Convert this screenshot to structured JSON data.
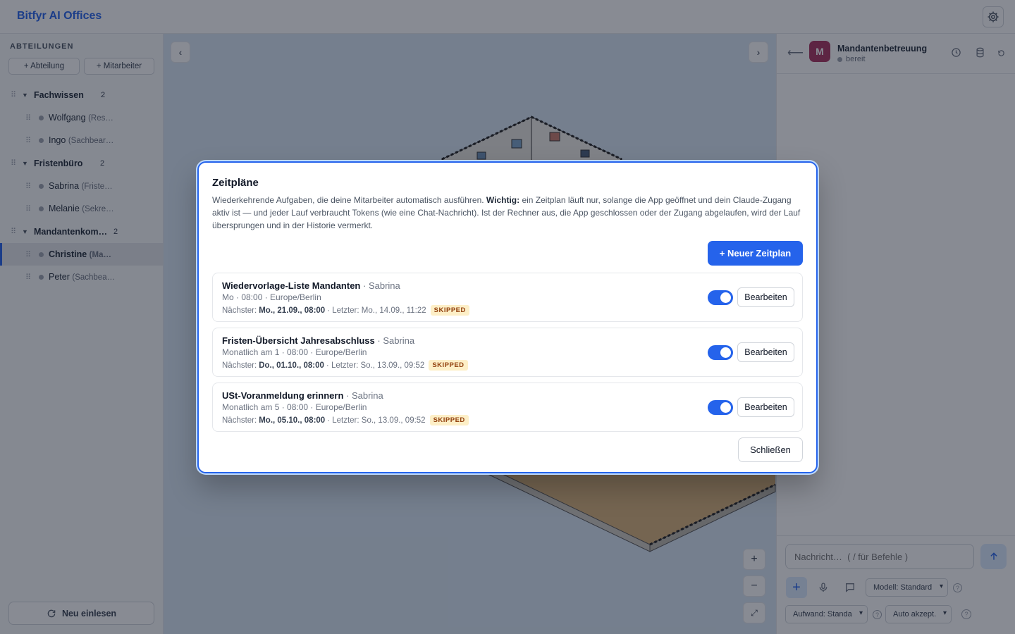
{
  "app": {
    "title": "Bitfyr AI Offices"
  },
  "sidebar": {
    "heading": "ABTEILUNGEN",
    "add_department": "+ Abteilung",
    "add_employee": "+ Mitarbeiter",
    "reload": "Neu einlesen",
    "departments": [
      {
        "name": "Fachwissen",
        "count": "2",
        "employees": [
          {
            "name": "Wolfgang",
            "role": "(Res…"
          },
          {
            "name": "Ingo",
            "role": "(Sachbear…"
          }
        ]
      },
      {
        "name": "Fristenbüro",
        "count": "2",
        "employees": [
          {
            "name": "Sabrina",
            "role": "(Friste…"
          },
          {
            "name": "Melanie",
            "role": "(Sekre…"
          }
        ]
      },
      {
        "name": "Mandantenkom…",
        "count": "2",
        "employees": [
          {
            "name": "Christine",
            "role": "(Ma…"
          },
          {
            "name": "Peter",
            "role": "(Sachbea…"
          }
        ]
      }
    ]
  },
  "canvas": {
    "prev": "‹",
    "next": "›",
    "zoom_in": "+",
    "zoom_out": "−",
    "fit": "⤢"
  },
  "chat": {
    "title": "Mandantenbetreuung",
    "avatar_letter": "M",
    "status": "bereit",
    "placeholder": "Nachricht…  ( / für Befehle )",
    "model": "Modell: Standard",
    "effort": "Aufwand: Standa",
    "accept": "Auto akzept."
  },
  "modal": {
    "title": "Zeitpläne",
    "desc_1": "Wiederkehrende Aufgaben, die deine Mitarbeiter automatisch ausführen. ",
    "desc_bold": "Wichtig:",
    "desc_2": " ein Zeitplan läuft nur, solange die App geöffnet und dein Claude-Zugang aktiv ist — und jeder Lauf verbraucht Tokens (wie eine Chat-Nachricht). Ist der Rechner aus, die App geschlossen oder der Zugang abgelaufen, wird der Lauf übersprungen und in der Historie vermerkt.",
    "new_button": "+ Neuer Zeitplan",
    "close_button": "Schließen",
    "edit_label": "Bearbeiten",
    "next_label": "Nächster:",
    "last_label": "· Letzter:",
    "schedules": [
      {
        "title": "Wiedervorlage-Liste Mandanten",
        "employee": "· Sabrina",
        "schedule": "Mo · 08:00 · Europe/Berlin",
        "next": "Mo., 21.09., 08:00",
        "last": "Mo., 14.09., 11:22",
        "status": "SKIPPED",
        "enabled": true
      },
      {
        "title": "Fristen-Übersicht Jahresabschluss",
        "employee": "· Sabrina",
        "schedule": "Monatlich am 1 · 08:00 · Europe/Berlin",
        "next": "Do., 01.10., 08:00",
        "last": "So., 13.09., 09:52",
        "status": "SKIPPED",
        "enabled": true
      },
      {
        "title": "USt-Voranmeldung erinnern",
        "employee": "· Sabrina",
        "schedule": "Monatlich am 5 · 08:00 · Europe/Berlin",
        "next": "Mo., 05.10., 08:00",
        "last": "So., 13.09., 09:52",
        "status": "SKIPPED",
        "enabled": true
      }
    ]
  }
}
